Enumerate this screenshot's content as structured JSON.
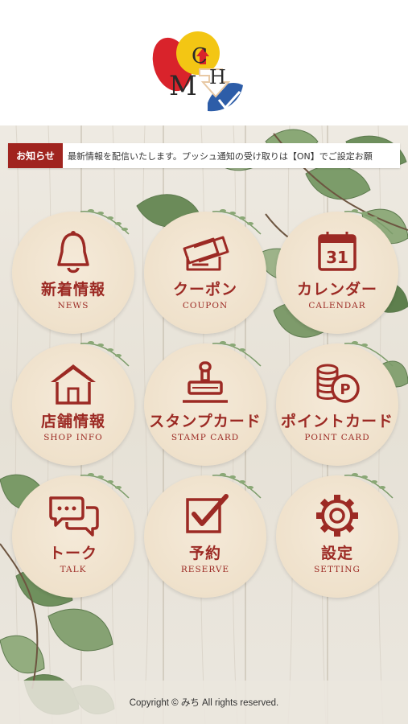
{
  "logo": {
    "letters": [
      "M",
      "C",
      "H"
    ]
  },
  "notice": {
    "label": "お知らせ",
    "text": "最新情報を配信いたします。プッシュ通知の受け取りは【ON】でご設定お願"
  },
  "menu": [
    {
      "jp": "新着情報",
      "en": "NEWS",
      "icon": "bell-icon"
    },
    {
      "jp": "クーポン",
      "en": "COUPON",
      "icon": "ticket-icon"
    },
    {
      "jp": "カレンダー",
      "en": "CALENDAR",
      "icon": "calendar-icon",
      "calendar_day": "31"
    },
    {
      "jp": "店舗情報",
      "en": "SHOP INFO",
      "icon": "house-icon"
    },
    {
      "jp": "スタンプカード",
      "en": "STAMP CARD",
      "icon": "stamp-icon"
    },
    {
      "jp": "ポイントカード",
      "en": "POINT CARD",
      "icon": "coins-icon",
      "coin_letter": "P"
    },
    {
      "jp": "トーク",
      "en": "TALK",
      "icon": "chat-icon"
    },
    {
      "jp": "予約",
      "en": "RESERVE",
      "icon": "checkbox-icon"
    },
    {
      "jp": "設定",
      "en": "SETTING",
      "icon": "gear-icon"
    }
  ],
  "footer": {
    "copyright": "Copyright © みち All rights reserved."
  },
  "colors": {
    "accent": "#a0241f",
    "menu_text": "#9c2a24",
    "logo_red": "#d9232b",
    "logo_yellow": "#f3c614",
    "logo_blue": "#2d5da8"
  }
}
